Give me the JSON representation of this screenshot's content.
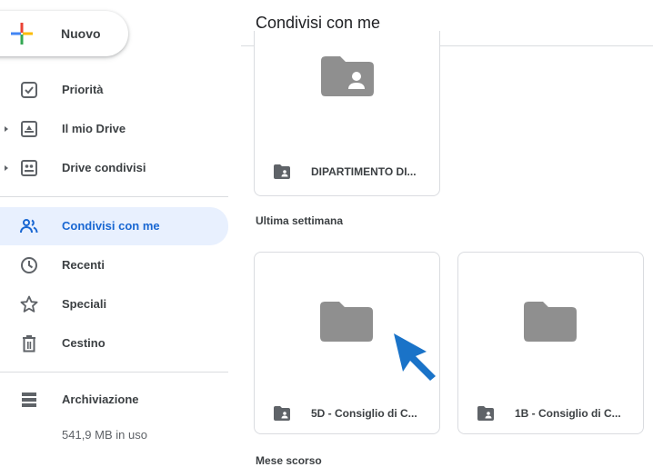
{
  "sidebar": {
    "new_button_label": "Nuovo",
    "items": [
      {
        "label": "Priorità",
        "icon": "priority-check-icon"
      },
      {
        "label": "Il mio Drive",
        "icon": "my-drive-icon"
      },
      {
        "label": "Drive condivisi",
        "icon": "shared-drives-icon"
      },
      {
        "label": "Condivisi con me",
        "icon": "shared-with-me-icon",
        "active": true
      },
      {
        "label": "Recenti",
        "icon": "clock-icon"
      },
      {
        "label": "Speciali",
        "icon": "star-icon"
      },
      {
        "label": "Cestino",
        "icon": "trash-icon"
      }
    ],
    "storage": {
      "label": "Archiviazione",
      "used": "541,9 MB in uso",
      "icon": "storage-icon"
    }
  },
  "main": {
    "title": "Condivisi con me",
    "sections": [
      {
        "label": "Ultima settimana"
      },
      {
        "label": "Mese scorso"
      }
    ],
    "cards": [
      {
        "name": "DIPARTIMENTO DI...",
        "type": "shared-folder"
      },
      {
        "name": "5D - Consiglio di C...",
        "type": "shared-folder"
      },
      {
        "name": "1B - Consiglio di C...",
        "type": "shared-folder"
      }
    ]
  },
  "colors": {
    "accent": "#1967d2",
    "active_bg": "#e8f0fe",
    "folder_gray": "#8f8f8f",
    "cursor_blue": "#1a73c8"
  }
}
